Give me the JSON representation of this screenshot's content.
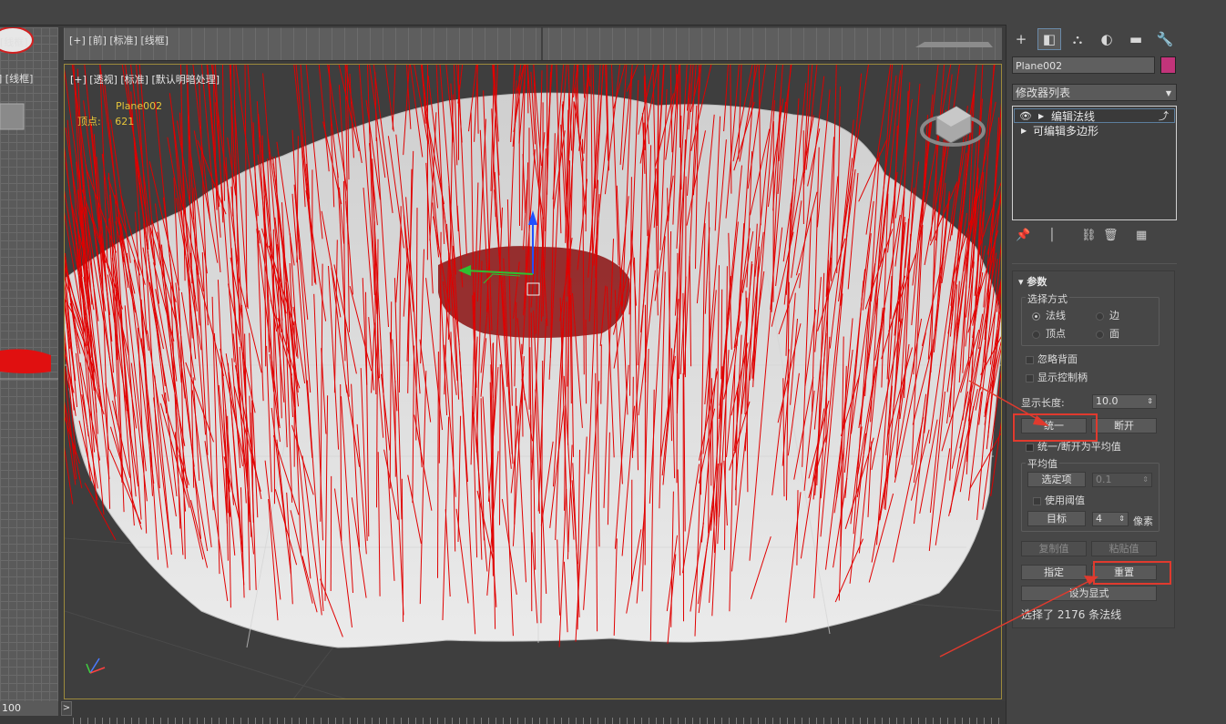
{
  "left_viewport": {
    "label_top": "[线框]",
    "label_mid": "] [线框]"
  },
  "front_viewport": {
    "label": "[+] [前] [标准] [线框]"
  },
  "perspective_viewport": {
    "label": "[+] [透视] [标准] [默认明暗处理]",
    "object_name": "Plane002",
    "vertex_label": "顶点:",
    "vertex_count": "621"
  },
  "timeline": {
    "frame_value": "100",
    "play_glyph": ">"
  },
  "command_panel": {
    "tabs": [
      {
        "icon": "plus-icon",
        "glyph": "+"
      },
      {
        "icon": "modify-icon",
        "glyph": "◧"
      },
      {
        "icon": "hierarchy-icon",
        "glyph": "⛬"
      },
      {
        "icon": "motion-icon",
        "glyph": "◐"
      },
      {
        "icon": "display-icon",
        "glyph": "▬"
      },
      {
        "icon": "utilities-icon",
        "glyph": "🔧"
      }
    ],
    "object_name": "Plane002",
    "object_color": "#c2347a",
    "modifier_list": "修改器列表",
    "stack": [
      {
        "label": "编辑法线",
        "selected": true
      },
      {
        "label": "可编辑多边形",
        "selected": false
      }
    ]
  },
  "params": {
    "title": "参数",
    "selection_mode": {
      "title": "选择方式",
      "options": [
        "法线",
        "边",
        "顶点",
        "面"
      ],
      "selected": "法线"
    },
    "ignore_backface": "忽略背面",
    "show_handles": "显示控制柄",
    "display_length_label": "显示长度:",
    "display_length_value": "10.0",
    "unify": "统一",
    "break": "断开",
    "unify_break_avg": "统一/断开为平均值",
    "average": {
      "title": "平均值",
      "selected_btn": "选定项",
      "selected_value": "0.1",
      "use_threshold": "使用阈值",
      "target_btn": "目标",
      "target_value": "4",
      "pixels": "像素"
    },
    "copy_value": "复制值",
    "paste_value": "粘贴值",
    "specify": "指定",
    "reset": "重置",
    "make_explicit": "设为显式",
    "status": "选择了 2176 条法线"
  },
  "annotation_color": "#e03a2e",
  "normal_color": "#e00000"
}
